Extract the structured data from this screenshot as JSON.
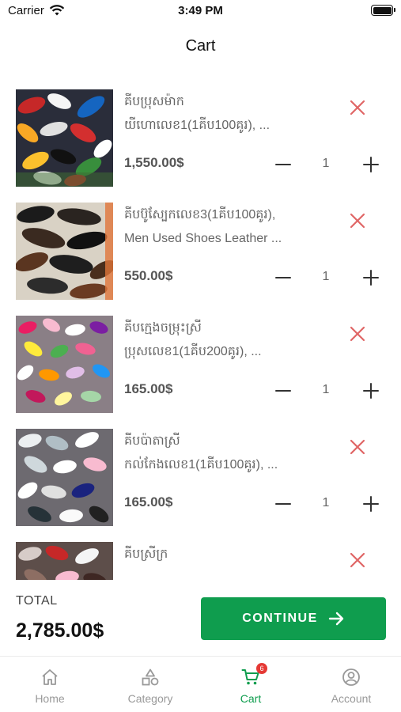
{
  "status_bar": {
    "carrier": "Carrier",
    "time": "3:49 PM"
  },
  "header": {
    "title": "Cart"
  },
  "items": [
    {
      "line1": "គីបប្រុសម៉ាក",
      "line2": "យីហោលេខ1(1គីប100គូរ), ...",
      "price": "1,550.00$",
      "qty": "1"
    },
    {
      "line1": "គីបប៊ូស្បែកលេខ3(1គីប100គូរ),",
      "line2": "Men Used Shoes Leather ...",
      "price": "550.00$",
      "qty": "1"
    },
    {
      "line1": "គីបក្មេងចម្រុះស្រី",
      "line2": "ប្រុសលេខ1(1គីប200គូរ), ...",
      "price": "165.00$",
      "qty": "1"
    },
    {
      "line1": "គីបប៉ាតាស្រី",
      "line2": "កល់កែងលេខ1(1គីប100គូរ), ...",
      "price": "165.00$",
      "qty": "1"
    },
    {
      "line1": "គីបស្រីក្រ",
      "line2": "",
      "price": "",
      "qty": ""
    }
  ],
  "total": {
    "label": "TOTAL",
    "value": "2,785.00$"
  },
  "continue_button": {
    "label": "CONTINUE",
    "icon": "arrow-right-icon",
    "color": "#0f9d4e"
  },
  "tabs": [
    {
      "label": "Home",
      "icon": "home-icon",
      "active": false
    },
    {
      "label": "Category",
      "icon": "category-icon",
      "active": false
    },
    {
      "label": "Cart",
      "icon": "cart-icon",
      "active": true,
      "badge": "6"
    },
    {
      "label": "Account",
      "icon": "account-icon",
      "active": false
    }
  ],
  "colors": {
    "accent": "#0f9d4e",
    "remove": "#e06666",
    "badge": "#e53935"
  }
}
